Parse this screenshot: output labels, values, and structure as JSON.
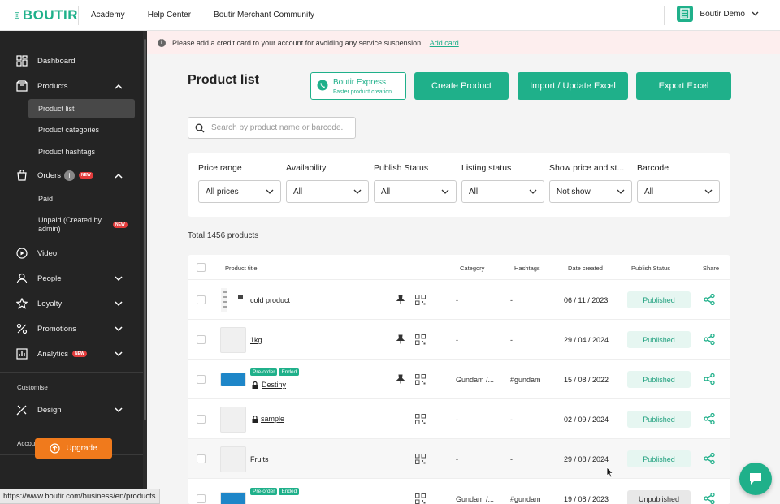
{
  "brand": {
    "name": "BOUTIR",
    "color": "#1fb08a"
  },
  "topnav": [
    "Academy",
    "Help Center",
    "Boutir Merchant Community"
  ],
  "store": {
    "name": "Boutir Demo"
  },
  "alert": {
    "message": "Please add a credit card to your account for avoiding any service suspension.",
    "link": "Add card"
  },
  "sidebar": {
    "items": [
      {
        "label": "Dashboard",
        "icon": "dashboard-icon"
      },
      {
        "label": "Products",
        "icon": "products-icon"
      },
      {
        "label": "Orders",
        "icon": "orders-icon",
        "badge": "NEW"
      },
      {
        "label": "Video",
        "icon": "video-icon"
      },
      {
        "label": "People",
        "icon": "people-icon"
      },
      {
        "label": "Loyalty",
        "icon": "loyalty-icon"
      },
      {
        "label": "Promotions",
        "icon": "promotions-icon"
      },
      {
        "label": "Analytics",
        "icon": "analytics-icon",
        "badge": "NEW"
      },
      {
        "label": "Design",
        "icon": "design-icon"
      }
    ],
    "product_sub": [
      "Product list",
      "Product categories",
      "Product hashtags"
    ],
    "order_sub": [
      "Paid",
      "Unpaid (Created by admin)"
    ],
    "unpaid_badge": "NEW",
    "section_customise": "Customise",
    "section_account": "Account",
    "upgrade": "Upgrade"
  },
  "main": {
    "title": "Product list",
    "express_title": "Boutir Express",
    "express_sub": "Faster product creation",
    "create": "Create Product",
    "import": "Import / Update Excel",
    "export": "Export Excel",
    "search_placeholder": "Search by product name or barcode.",
    "filters": [
      {
        "label": "Price range",
        "value": "All prices"
      },
      {
        "label": "Availability",
        "value": "All"
      },
      {
        "label": "Publish Status",
        "value": "All"
      },
      {
        "label": "Listing status",
        "value": "All"
      },
      {
        "label": "Show price and st...",
        "value": "Not show"
      },
      {
        "label": "Barcode",
        "value": "All"
      }
    ],
    "total": "Total 1456 products"
  },
  "table": {
    "headers": [
      "Product title",
      "Category",
      "Hashtags",
      "Date created",
      "Publish Status",
      "Share"
    ],
    "rows": [
      {
        "name": "cold product",
        "category": "-",
        "hashtags": "-",
        "date": "06 / 11 / 2023",
        "status": "Published"
      },
      {
        "name": "1kg",
        "category": "-",
        "hashtags": "-",
        "date": "29 / 04 / 2024",
        "status": "Published"
      },
      {
        "name": "Destiny",
        "tag1": "Pre-order",
        "tag2": "Ended",
        "category": "Gundam /...",
        "hashtags": "#gundam",
        "date": "15 / 08 / 2022",
        "status": "Published"
      },
      {
        "name": "sample",
        "category": "-",
        "hashtags": "-",
        "date": "02 / 09 / 2024",
        "status": "Published"
      },
      {
        "name": "Fruits",
        "category": "-",
        "hashtags": "-",
        "date": "29 / 08 / 2024",
        "status": "Published"
      },
      {
        "tag1": "Pre-order",
        "tag2": "Ended",
        "category": "Gundam /...",
        "hashtags": "#gundam",
        "date": "19 / 08 / 2023",
        "status": "Unpublished"
      }
    ]
  },
  "status_url": "https://www.boutir.com/business/en/products"
}
